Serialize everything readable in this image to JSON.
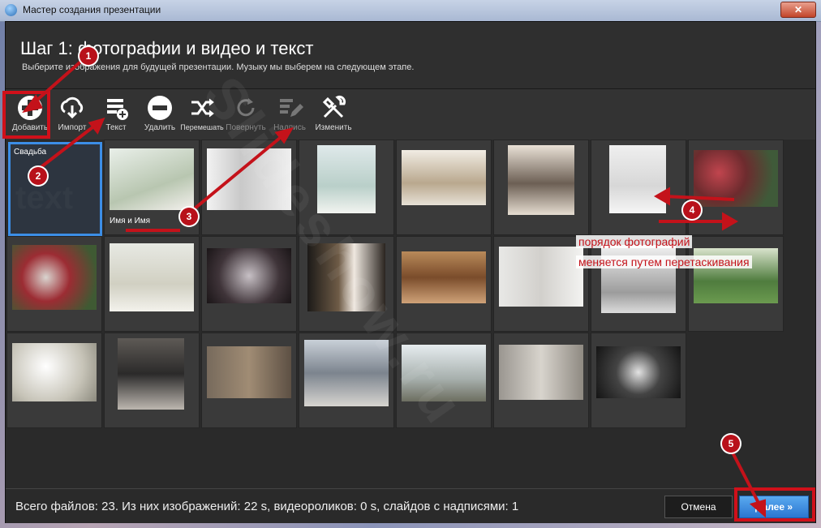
{
  "window": {
    "title": "Мастер создания презентации",
    "close_label": "✕"
  },
  "header": {
    "title": "Шаг 1: фотографии и видео и текст",
    "subtitle": "Выберите изображения для будущей презентации. Музыку мы выберем на следующем этапе."
  },
  "toolbar": {
    "items": [
      {
        "label": "Добавить",
        "icon": "plus-icon"
      },
      {
        "label": "Импорт",
        "icon": "cloud-download-icon"
      },
      {
        "label": "Текст",
        "icon": "text-add-icon"
      },
      {
        "label": "Удалить",
        "icon": "minus-icon"
      },
      {
        "label": "Перемешать",
        "icon": "shuffle-icon"
      },
      {
        "label": "Повернуть",
        "icon": "rotate-icon"
      },
      {
        "label": "Надпись",
        "icon": "caption-edit-icon"
      },
      {
        "label": "Изменить",
        "icon": "tools-icon"
      }
    ]
  },
  "grid": {
    "text_slide": {
      "caption": "Свадьба",
      "bg_text": "text"
    },
    "photo_caption": "Имя и Имя",
    "photo_count": 22
  },
  "annotations": {
    "badges": [
      "1",
      "2",
      "3",
      "4",
      "5"
    ],
    "note_line1": "порядок фотографий",
    "note_line2": "меняется путем перетаскивания",
    "watermark": "Slideshow.ru"
  },
  "status": {
    "text": "Всего файлов: 23. Из них изображений: 22 s, видеороликов: 0 s, слайдов с надписями: 1",
    "cancel_label": "Отмена",
    "next_label": "Далее »"
  },
  "colors": {
    "accent": "#3c8ee6",
    "annotation": "#d0101a"
  }
}
